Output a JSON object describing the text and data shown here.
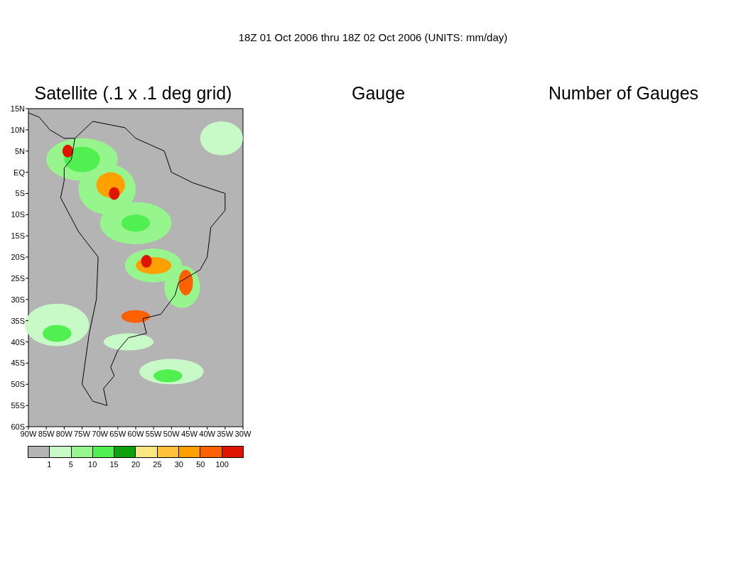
{
  "title": "18Z 01 Oct 2006 thru 18Z 02 Oct 2006 (UNITS: mm/day)",
  "panels": [
    {
      "title": "Satellite (.1 x .1 deg grid)"
    },
    {
      "title": "Gauge"
    },
    {
      "title": "Number of Gauges"
    }
  ],
  "map": {
    "y_labels": [
      "15N",
      "10N",
      "5N",
      "EQ",
      "5S",
      "10S",
      "15S",
      "20S",
      "25S",
      "30S",
      "35S",
      "40S",
      "45S",
      "50S",
      "55S",
      "60S"
    ],
    "x_labels": [
      "90W",
      "85W",
      "80W",
      "75W",
      "70W",
      "65W",
      "60W",
      "55W",
      "50W",
      "45W",
      "40W",
      "35W",
      "30W"
    ]
  },
  "legend": [
    {
      "color": "#b4b4b4",
      "label": "1"
    },
    {
      "color": "#c8fac8",
      "label": "5"
    },
    {
      "color": "#96f58c",
      "label": "10"
    },
    {
      "color": "#50f050",
      "label": "15"
    },
    {
      "color": "#0fa00f",
      "label": "20"
    },
    {
      "color": "#fae682",
      "label": "25"
    },
    {
      "color": "#ffc03c",
      "label": "30"
    },
    {
      "color": "#ffa000",
      "label": "50"
    },
    {
      "color": "#ff6000",
      "label": "100"
    },
    {
      "color": "#e11400"
    }
  ]
}
